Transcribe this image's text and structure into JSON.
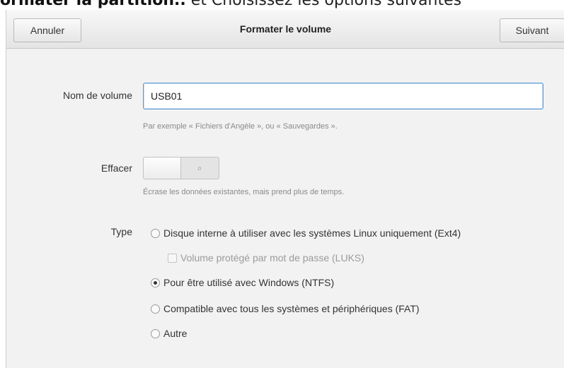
{
  "context": {
    "bold_text": "ormater la partition..",
    "rest_text": "et Choisissez les options suivantes"
  },
  "header": {
    "cancel_label": "Annuler",
    "title": "Formater le volume",
    "next_label": "Suivant"
  },
  "volume_name": {
    "label": "Nom de volume",
    "value": "USB01",
    "hint": "Par exemple « Fichiers d'Angèle », ou « Sauvegardes »."
  },
  "erase": {
    "label": "Effacer",
    "state_text": "o",
    "hint": "Écrase les données existantes, mais prend plus de temps."
  },
  "type": {
    "label": "Type",
    "options": [
      {
        "label": "Disque interne à utiliser avec les systèmes Linux uniquement (Ext4)",
        "selected": false
      },
      {
        "label": "Volume protégé par mot de passe (LUKS)",
        "checked": false,
        "disabled": true
      },
      {
        "label": "Pour être utilisé avec Windows (NTFS)",
        "selected": true
      },
      {
        "label": "Compatible avec tous les systèmes et périphériques (FAT)",
        "selected": false
      },
      {
        "label": "Autre",
        "selected": false
      }
    ]
  }
}
